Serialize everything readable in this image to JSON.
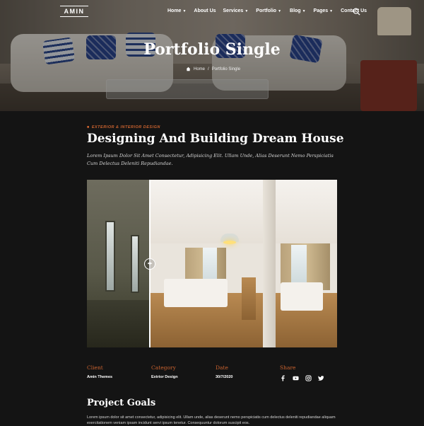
{
  "header": {
    "logo": "AMIN",
    "menu": [
      {
        "label": "Home",
        "caret": true
      },
      {
        "label": "About Us",
        "caret": false
      },
      {
        "label": "Services",
        "caret": true
      },
      {
        "label": "Portfolio",
        "caret": true
      },
      {
        "label": "Blog",
        "caret": true
      },
      {
        "label": "Pages",
        "caret": true
      },
      {
        "label": "Contact Us",
        "caret": false
      }
    ],
    "search_icon": "search-icon"
  },
  "hero": {
    "title": "Portfolio Single",
    "breadcrumb": {
      "home": "Home",
      "separator": "/",
      "current": "Portfolio Single"
    }
  },
  "project": {
    "tag": "EXTERIOR & INTERIOR DESIGN",
    "title": "Designing And Building Dream House",
    "subtitle": "Lorem Ipsum Dolor Sit Amet Consectetur, Adipisicing Elit. Ullam Unde, Alias Deserunt Nemo Perspiciatis Cum Delectus Deleniti Repudiandae."
  },
  "meta": {
    "client": {
      "label": "Client",
      "value": "Amin Themes"
    },
    "category": {
      "label": "Category",
      "value": "Extrior Design"
    },
    "date": {
      "label": "Date",
      "value": "30/7/2020"
    },
    "share": {
      "label": "Share",
      "icons": [
        "facebook-icon",
        "youtube-icon",
        "instagram-icon",
        "twitter-icon"
      ]
    }
  },
  "goals": {
    "heading": "Project Goals",
    "text": "Lorem ipsum dolor sit amet consectetur, adipisicing elit. Ullam unde, alias deserunt nemo perspiciatis cum delectus deleniti repudiandae aliquam exercitationem veniam ipsam incidunt servi ipsum tenetur. Consequuntur dolorum suscipit eos."
  },
  "colors": {
    "accent": "#c9622f",
    "background": "#141414"
  }
}
